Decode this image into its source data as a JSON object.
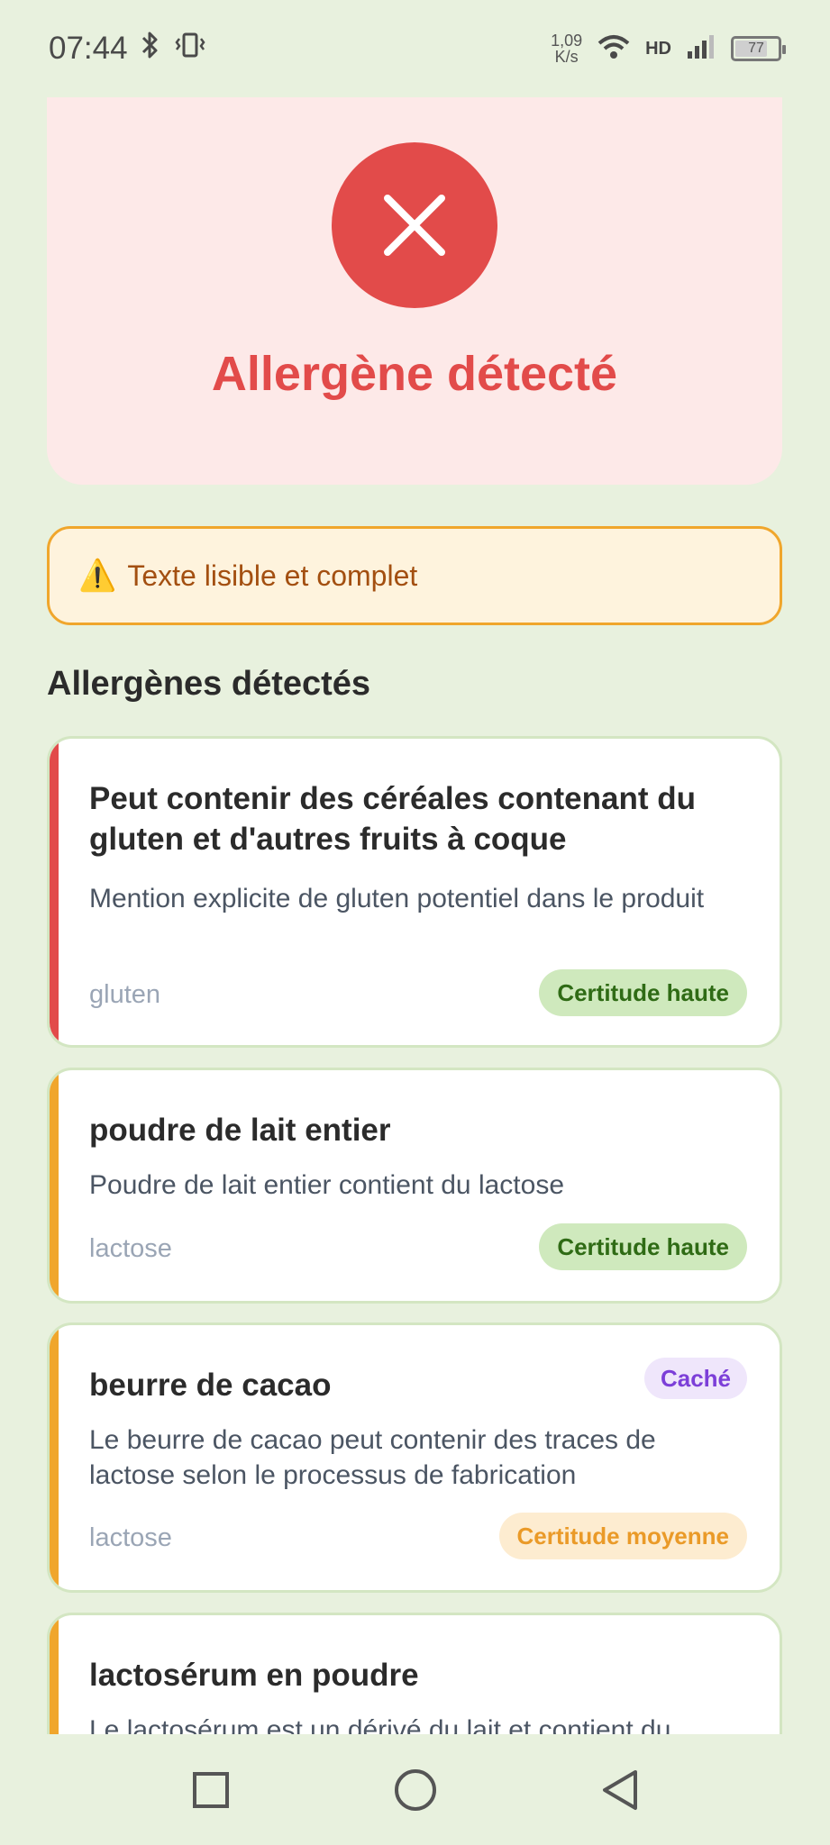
{
  "status_bar": {
    "time": "07:44",
    "net_speed_value": "1,09",
    "net_speed_unit": "K/s",
    "network_label": "HD",
    "battery": "77"
  },
  "result": {
    "title": "Allergène détecté",
    "icon": "close-icon",
    "color": "#e24b4a"
  },
  "warning": {
    "icon": "⚠️",
    "text": "Texte lisible et complet"
  },
  "section_title": "Allergènes détectés",
  "allergens": [
    {
      "title": "Peut contenir des céréales contenant du gluten et d'autres fruits à coque",
      "description": "Mention explicite de gluten potentiel dans le produit",
      "tag": "gluten",
      "certainty": "Certitude haute"
    },
    {
      "title": "poudre de lait entier",
      "description": "Poudre de lait entier contient du lactose",
      "tag": "lactose",
      "certainty": "Certitude haute"
    },
    {
      "title": "beurre de cacao",
      "hidden_label": "Caché",
      "description": "Le beurre de cacao peut contenir des traces de lactose selon le processus de fabrication",
      "tag": "lactose",
      "certainty": "Certitude moyenne"
    },
    {
      "title": "lactosérum en poudre",
      "description": "Le lactosérum est un dérivé du lait et contient du"
    }
  ],
  "nav": {
    "recent": "square-icon",
    "home": "circle-icon",
    "back": "triangle-back-icon"
  }
}
